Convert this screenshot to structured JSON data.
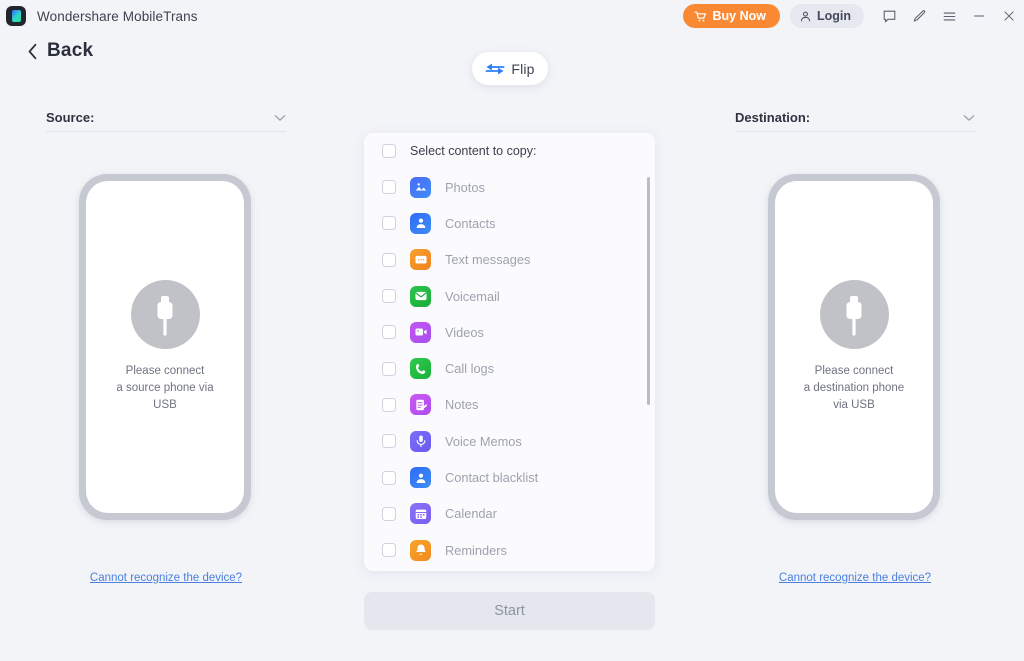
{
  "titlebar": {
    "app_name": "Wondershare MobileTrans",
    "logo_icon": "mobiletrans-logo-icon",
    "buy_label": "Buy Now",
    "buy_icon": "shopping-cart-icon",
    "buy_color": "#f98a33",
    "login_label": "Login",
    "login_icon": "user-icon",
    "icons": [
      {
        "name": "feedback-icon",
        "title": "Feedback"
      },
      {
        "name": "edit-pen-icon",
        "title": "Edit"
      },
      {
        "name": "hamburger-menu-icon",
        "title": "Menu"
      },
      {
        "name": "minimize-icon",
        "title": "Minimize"
      },
      {
        "name": "close-icon",
        "title": "Close"
      }
    ]
  },
  "back": {
    "label": "Back",
    "icon": "chevron-left-icon"
  },
  "flip": {
    "label": "Flip",
    "icon": "flip-arrows-icon",
    "accent": "#2d7ff9"
  },
  "source": {
    "title": "Source:",
    "chevron_icon": "chevron-down-icon",
    "phone_text": "Please connect\na source phone via\nUSB",
    "usb_icon": "usb-plug-icon",
    "link": "Cannot recognize the device?",
    "link_color": "#4c7fe0"
  },
  "destination": {
    "title": "Destination:",
    "chevron_icon": "chevron-down-icon",
    "phone_text": "Please connect\na destination phone\nvia USB",
    "usb_icon": "usb-plug-icon",
    "link": "Cannot recognize the device?",
    "link_color": "#4c7fe0"
  },
  "content_panel": {
    "select_all_label": "Select content to copy:",
    "select_all_checked": false,
    "items": [
      {
        "label": "Photos",
        "icon": "photos-icon",
        "color1": "#4a6bf5",
        "color2": "#3f8df8",
        "checked": false
      },
      {
        "label": "Contacts",
        "icon": "contacts-icon",
        "color1": "#2f6bf5",
        "color2": "#3f8df8",
        "checked": false
      },
      {
        "label": "Text messages",
        "icon": "text-messages-icon",
        "color1": "#f7a02a",
        "color2": "#f08320",
        "checked": false
      },
      {
        "label": "Voicemail",
        "icon": "voicemail-icon",
        "color1": "#2fc44d",
        "color2": "#18ad38",
        "checked": false
      },
      {
        "label": "Videos",
        "icon": "videos-icon",
        "color1": "#c257f0",
        "color2": "#a84df0",
        "checked": false
      },
      {
        "label": "Call logs",
        "icon": "call-logs-icon",
        "color1": "#31c94f",
        "color2": "#18b23a",
        "checked": false
      },
      {
        "label": "Notes",
        "icon": "notes-icon",
        "color1": "#c85cf2",
        "color2": "#b049ef",
        "checked": false
      },
      {
        "label": "Voice Memos",
        "icon": "voice-memos-icon",
        "color1": "#7a6ef5",
        "color2": "#6a5af3",
        "checked": false
      },
      {
        "label": "Contact blacklist",
        "icon": "contact-blacklist-icon",
        "color1": "#2f6bf5",
        "color2": "#3f8df8",
        "checked": false
      },
      {
        "label": "Calendar",
        "icon": "calendar-icon",
        "color1": "#8a72f5",
        "color2": "#7a5ef3",
        "checked": false
      },
      {
        "label": "Reminders",
        "icon": "reminders-icon",
        "color1": "#f9a42a",
        "color2": "#f08a1e",
        "checked": false
      }
    ],
    "scrollbar": {
      "name": "content-list-scrollbar"
    }
  },
  "start": {
    "label": "Start",
    "enabled": false
  }
}
